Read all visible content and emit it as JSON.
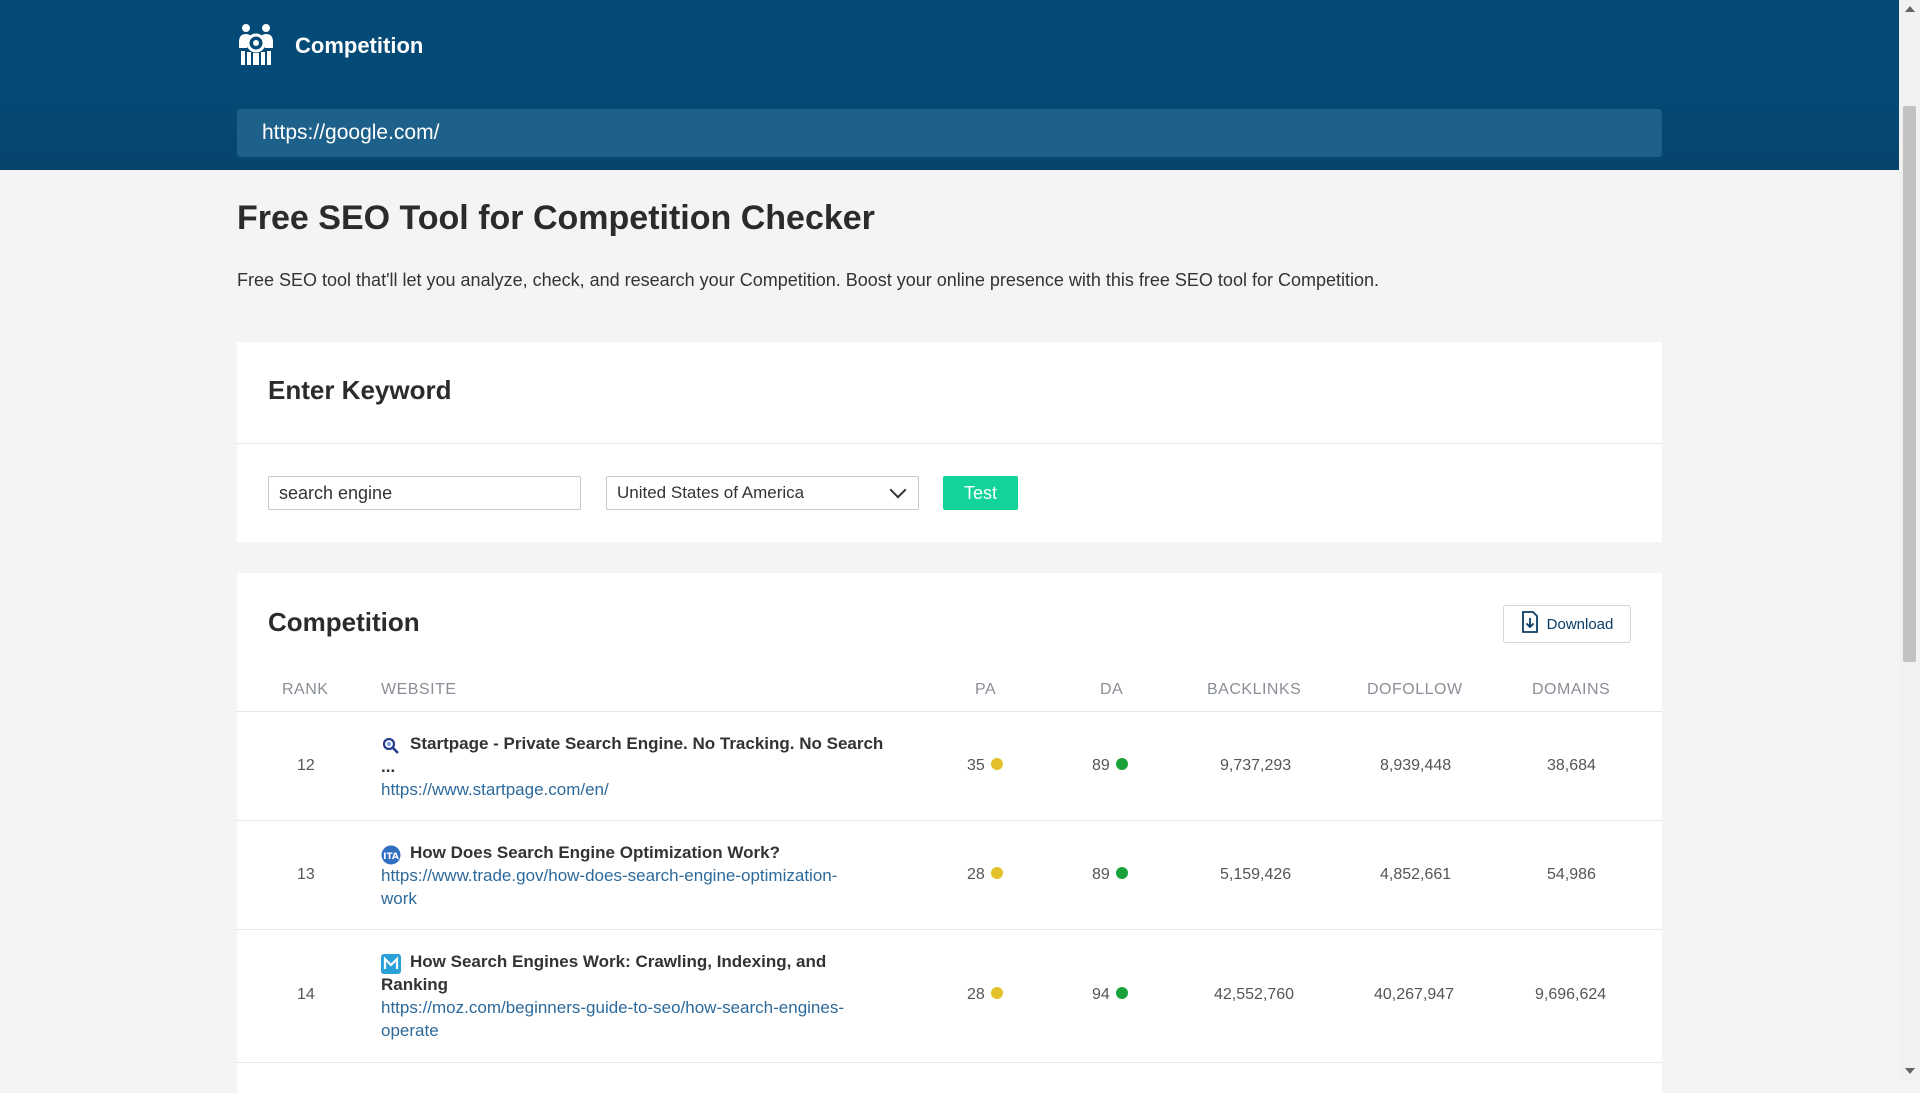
{
  "header": {
    "brand_title": "Competition",
    "url_value": "https://google.com/"
  },
  "page": {
    "title": "Free SEO Tool for Competition Checker",
    "intro": "Free SEO tool that'll let you analyze, check, and research your Competition. Boost your online presence with this free SEO tool for Competition."
  },
  "keyword_form": {
    "title": "Enter Keyword",
    "keyword_value": "search engine",
    "country_selected": "United States of America",
    "test_label": "Test"
  },
  "competition": {
    "title": "Competition",
    "download_label": "Download",
    "columns": [
      "RANK",
      "WEBSITE",
      "PA",
      "DA",
      "BACKLINKS",
      "DOFOLLOW",
      "DOMAINS"
    ],
    "rows": [
      {
        "rank": "12",
        "favicon": "magnifier-favicon-icon",
        "title_line1": "Startpage - Private Search Engine. No Tracking. No Search",
        "title_line2": "...",
        "url_line1": "https://www.startpage.com/en/",
        "url_line2": "",
        "pa": "35",
        "pa_status": "yellow",
        "da": "89",
        "da_status": "green",
        "backlinks": "9,737,293",
        "dofollow": "8,939,448",
        "domains": "38,684"
      },
      {
        "rank": "13",
        "favicon": "ita-favicon-icon",
        "title_line1": "How Does Search Engine Optimization Work?",
        "title_line2": "",
        "url_line1": "https://www.trade.gov/how-does-search-engine-optimization-",
        "url_line2": "work",
        "pa": "28",
        "pa_status": "yellow",
        "da": "89",
        "da_status": "green",
        "backlinks": "5,159,426",
        "dofollow": "4,852,661",
        "domains": "54,986"
      },
      {
        "rank": "14",
        "favicon": "moz-favicon-icon",
        "title_line1": "How Search Engines Work: Crawling, Indexing, and",
        "title_line2": "Ranking",
        "url_line1": "https://moz.com/beginners-guide-to-seo/how-search-engines-",
        "url_line2": "operate",
        "pa": "28",
        "pa_status": "yellow",
        "da": "94",
        "da_status": "green",
        "backlinks": "42,552,760",
        "dofollow": "40,267,947",
        "domains": "9,696,624"
      }
    ]
  },
  "colors": {
    "header_bg": "#044a76",
    "url_bar_bg": "#1d6089",
    "test_button": "#12d39a",
    "link": "#2d6a9c",
    "status_yellow": "#e2c12a",
    "status_green": "#1aa33a"
  }
}
